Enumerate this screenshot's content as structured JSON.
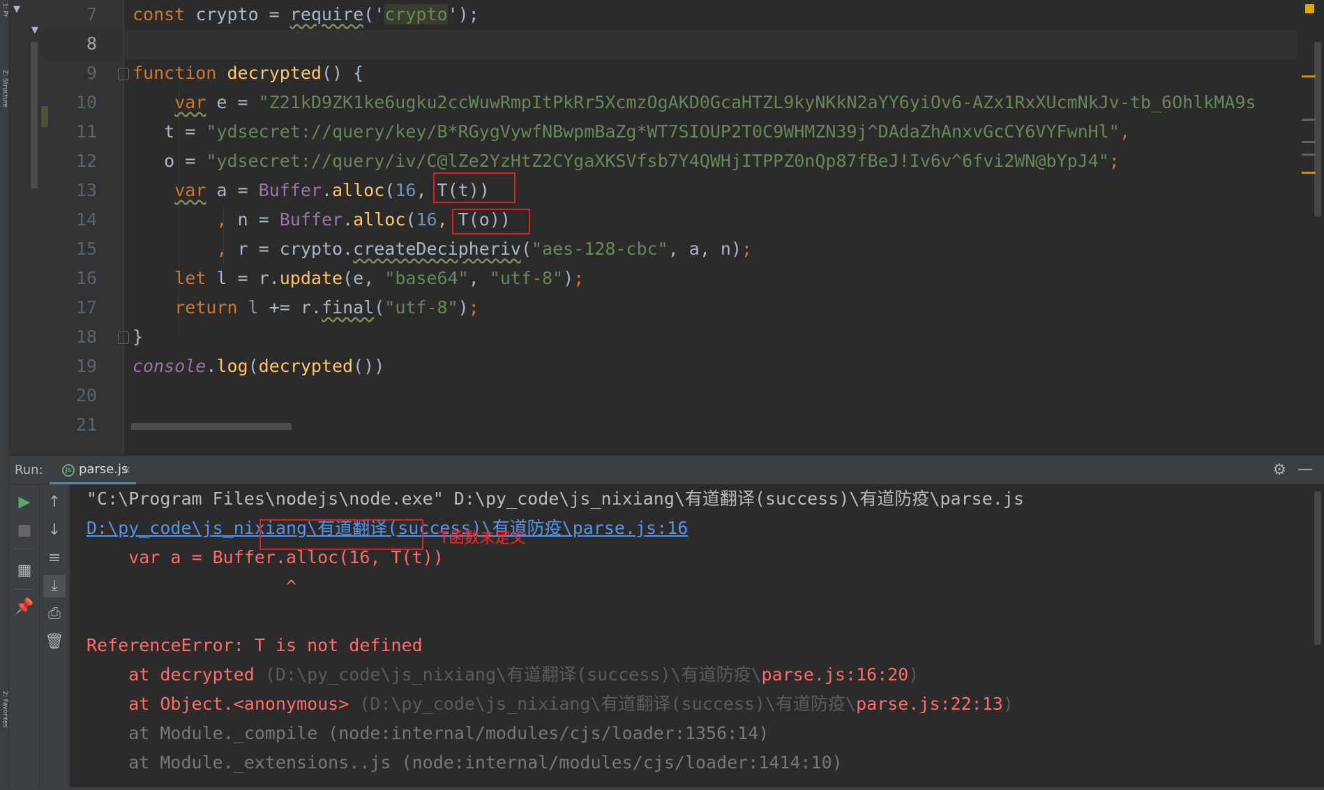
{
  "side_strip": {
    "top_label": "1: Pr",
    "mid_label": "Z: Structure",
    "bottom_label": "2: Favorites"
  },
  "editor": {
    "line_numbers": [
      "7",
      "8",
      "9",
      "10",
      "11",
      "12",
      "13",
      "14",
      "15",
      "16",
      "17",
      "18",
      "19",
      "20",
      "21"
    ],
    "current_line": "8"
  },
  "code": {
    "l7": {
      "kw": "const",
      "a": " crypto = ",
      "require": "require",
      "b": "('",
      "crypto": "crypto",
      "c": "');"
    },
    "l9": {
      "kw": "function",
      "sp": " ",
      "fn": "decrypted",
      "rest": "() {"
    },
    "l10": {
      "ind": "    ",
      "kw": "var",
      "a": " e = ",
      "str": "\"Z21kD9ZK1ke6ugku2ccWuwRmpItPkRr5XcmzOgAKD0GcaHTZL9kyNKkN2aYY6yiOv6-AZx1RxXUcmNkJv-tb_6OhlkMA9s"
    },
    "l11": {
      "ind": "   ",
      "a": "t = ",
      "str": "\"ydsecret://query/key/B*RGygVywfNBwpmBaZg*WT7SIOUP2T0C9WHMZN39j^DAdaZhAnxvGcCY6VYFwnHl\"",
      "comma": ","
    },
    "l12": {
      "ind": "   ",
      "a": "o = ",
      "str": "\"ydsecret://query/iv/C@lZe2YzHtZ2CYgaXKSVfsb7Y4QWHjITPPZ0nQp87fBeJ!Iv6v^6fvi2WN@bYpJ4\"",
      "semi": ";"
    },
    "l13": {
      "ind": "    ",
      "kw": "var",
      "a": " a = ",
      "cls": "Buffer",
      "b": ".",
      "fn": "alloc",
      "c": "(",
      "num": "16",
      "d": ", T(t))"
    },
    "l14": {
      "ind": "        ",
      "comma": ",",
      "a": " n = ",
      "cls": "Buffer",
      "b": ".",
      "fn": "alloc",
      "c": "(",
      "num": "16",
      "d": ", T(o))"
    },
    "l15": {
      "ind": "        ",
      "comma": ",",
      "a": " r = crypto.",
      "fn": "createDecipheriv",
      "b": "(",
      "str": "\"aes-128-cbc\"",
      "c": ", a, n)",
      "semi": ";"
    },
    "l16": {
      "ind": "    ",
      "kw": "let",
      "a": " l = r.",
      "fn": "update",
      "b": "(e, ",
      "s1": "\"base64\"",
      "c": ", ",
      "s2": "\"utf-8\"",
      "d": ")",
      "semi": ";"
    },
    "l17": {
      "ind": "    ",
      "kw": "return",
      "sp": " ",
      "l": "l",
      "a": " += r.",
      "fn": "final",
      "b": "(",
      "str": "\"utf-8\"",
      "c": ")",
      "semi": ";"
    },
    "l18": {
      "a": "}"
    },
    "l19": {
      "var": "console",
      "a": ".",
      "fn": "log",
      "b": "(",
      "fn2": "decrypted",
      "c": "())"
    }
  },
  "run": {
    "label": "Run:",
    "tab_label": "parse.js",
    "tab_close": "×",
    "tab_icon": "nodejs-icon"
  },
  "console": {
    "line1": "\"C:\\Program Files\\nodejs\\node.exe\" D:\\py_code\\js_nixiang\\有道翻译(success)\\有道防疫\\parse.js",
    "line2": "D:\\py_code\\js_nixiang\\有道翻译(success)\\有道防疫\\parse.js:16",
    "line3": "    var a = Buffer.alloc(16, T(t))",
    "line4": "                   ^",
    "err_prefix": "ReferenceError:",
    "err_msg": " T is not defined",
    "note": "T函数未定义",
    "at1_a": "    at decrypted ",
    "at1_b": "(D:\\py_code\\js_nixiang\\有道翻译(success)\\有道防疫\\",
    "at1_c": "parse.js:16:20",
    "at1_d": ")",
    "at2_a": "    at Object.<anonymous> ",
    "at2_b": "(D:\\py_code\\js_nixiang\\有道翻译(success)\\有道防疫\\",
    "at2_c": "parse.js:22:13",
    "at2_d": ")",
    "at3": "    at Module._compile (node:internal/modules/cjs/loader:1356:14)",
    "at4": "    at Module._extensions..js (node:internal/modules/cjs/loader:1414:10)"
  },
  "colors": {
    "keyword": "#cc7832",
    "function": "#ffc66d",
    "string": "#6a8759",
    "number": "#6897bb",
    "console_error": "#ff6b68",
    "console_link": "#5394ec",
    "annotation_red": "#e02020"
  }
}
